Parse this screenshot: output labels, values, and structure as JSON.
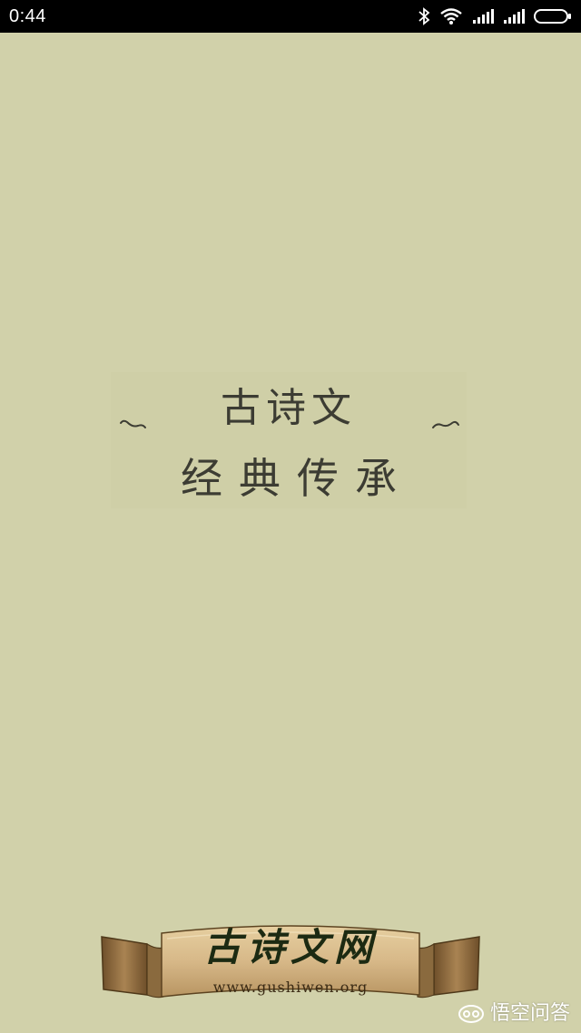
{
  "status_bar": {
    "time": "0:44",
    "icons": [
      "bluetooth-icon",
      "wifi-icon",
      "signal-icon",
      "signal-icon",
      "battery-icon"
    ]
  },
  "splash": {
    "title": "古诗文",
    "subtitle": "经典传承"
  },
  "logo": {
    "title": "古诗文网",
    "url": "www.gushiwen.org"
  },
  "watermark": {
    "text": "悟空问答"
  },
  "colors": {
    "background": "#d1d1aa",
    "text": "#3c3c33",
    "status_bar": "#000000",
    "scroll_paper": "#d7b888",
    "scroll_dark": "#8a6a3e"
  }
}
